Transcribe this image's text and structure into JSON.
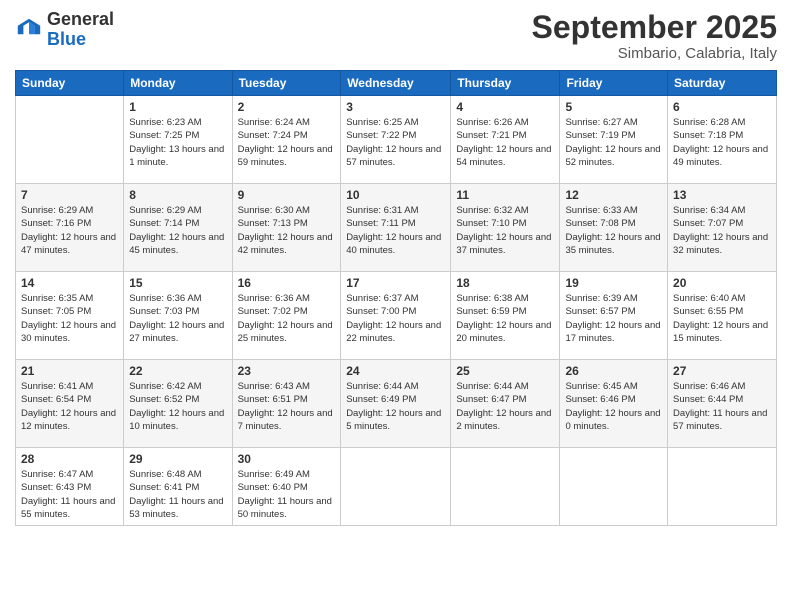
{
  "header": {
    "logo_general": "General",
    "logo_blue": "Blue",
    "month_title": "September 2025",
    "location": "Simbario, Calabria, Italy"
  },
  "weekdays": [
    "Sunday",
    "Monday",
    "Tuesday",
    "Wednesday",
    "Thursday",
    "Friday",
    "Saturday"
  ],
  "weeks": [
    [
      {
        "day": "",
        "info": ""
      },
      {
        "day": "1",
        "info": "Sunrise: 6:23 AM\nSunset: 7:25 PM\nDaylight: 13 hours\nand 1 minute."
      },
      {
        "day": "2",
        "info": "Sunrise: 6:24 AM\nSunset: 7:24 PM\nDaylight: 12 hours\nand 59 minutes."
      },
      {
        "day": "3",
        "info": "Sunrise: 6:25 AM\nSunset: 7:22 PM\nDaylight: 12 hours\nand 57 minutes."
      },
      {
        "day": "4",
        "info": "Sunrise: 6:26 AM\nSunset: 7:21 PM\nDaylight: 12 hours\nand 54 minutes."
      },
      {
        "day": "5",
        "info": "Sunrise: 6:27 AM\nSunset: 7:19 PM\nDaylight: 12 hours\nand 52 minutes."
      },
      {
        "day": "6",
        "info": "Sunrise: 6:28 AM\nSunset: 7:18 PM\nDaylight: 12 hours\nand 49 minutes."
      }
    ],
    [
      {
        "day": "7",
        "info": "Sunrise: 6:29 AM\nSunset: 7:16 PM\nDaylight: 12 hours\nand 47 minutes."
      },
      {
        "day": "8",
        "info": "Sunrise: 6:29 AM\nSunset: 7:14 PM\nDaylight: 12 hours\nand 45 minutes."
      },
      {
        "day": "9",
        "info": "Sunrise: 6:30 AM\nSunset: 7:13 PM\nDaylight: 12 hours\nand 42 minutes."
      },
      {
        "day": "10",
        "info": "Sunrise: 6:31 AM\nSunset: 7:11 PM\nDaylight: 12 hours\nand 40 minutes."
      },
      {
        "day": "11",
        "info": "Sunrise: 6:32 AM\nSunset: 7:10 PM\nDaylight: 12 hours\nand 37 minutes."
      },
      {
        "day": "12",
        "info": "Sunrise: 6:33 AM\nSunset: 7:08 PM\nDaylight: 12 hours\nand 35 minutes."
      },
      {
        "day": "13",
        "info": "Sunrise: 6:34 AM\nSunset: 7:07 PM\nDaylight: 12 hours\nand 32 minutes."
      }
    ],
    [
      {
        "day": "14",
        "info": "Sunrise: 6:35 AM\nSunset: 7:05 PM\nDaylight: 12 hours\nand 30 minutes."
      },
      {
        "day": "15",
        "info": "Sunrise: 6:36 AM\nSunset: 7:03 PM\nDaylight: 12 hours\nand 27 minutes."
      },
      {
        "day": "16",
        "info": "Sunrise: 6:36 AM\nSunset: 7:02 PM\nDaylight: 12 hours\nand 25 minutes."
      },
      {
        "day": "17",
        "info": "Sunrise: 6:37 AM\nSunset: 7:00 PM\nDaylight: 12 hours\nand 22 minutes."
      },
      {
        "day": "18",
        "info": "Sunrise: 6:38 AM\nSunset: 6:59 PM\nDaylight: 12 hours\nand 20 minutes."
      },
      {
        "day": "19",
        "info": "Sunrise: 6:39 AM\nSunset: 6:57 PM\nDaylight: 12 hours\nand 17 minutes."
      },
      {
        "day": "20",
        "info": "Sunrise: 6:40 AM\nSunset: 6:55 PM\nDaylight: 12 hours\nand 15 minutes."
      }
    ],
    [
      {
        "day": "21",
        "info": "Sunrise: 6:41 AM\nSunset: 6:54 PM\nDaylight: 12 hours\nand 12 minutes."
      },
      {
        "day": "22",
        "info": "Sunrise: 6:42 AM\nSunset: 6:52 PM\nDaylight: 12 hours\nand 10 minutes."
      },
      {
        "day": "23",
        "info": "Sunrise: 6:43 AM\nSunset: 6:51 PM\nDaylight: 12 hours\nand 7 minutes."
      },
      {
        "day": "24",
        "info": "Sunrise: 6:44 AM\nSunset: 6:49 PM\nDaylight: 12 hours\nand 5 minutes."
      },
      {
        "day": "25",
        "info": "Sunrise: 6:44 AM\nSunset: 6:47 PM\nDaylight: 12 hours\nand 2 minutes."
      },
      {
        "day": "26",
        "info": "Sunrise: 6:45 AM\nSunset: 6:46 PM\nDaylight: 12 hours\nand 0 minutes."
      },
      {
        "day": "27",
        "info": "Sunrise: 6:46 AM\nSunset: 6:44 PM\nDaylight: 11 hours\nand 57 minutes."
      }
    ],
    [
      {
        "day": "28",
        "info": "Sunrise: 6:47 AM\nSunset: 6:43 PM\nDaylight: 11 hours\nand 55 minutes."
      },
      {
        "day": "29",
        "info": "Sunrise: 6:48 AM\nSunset: 6:41 PM\nDaylight: 11 hours\nand 53 minutes."
      },
      {
        "day": "30",
        "info": "Sunrise: 6:49 AM\nSunset: 6:40 PM\nDaylight: 11 hours\nand 50 minutes."
      },
      {
        "day": "",
        "info": ""
      },
      {
        "day": "",
        "info": ""
      },
      {
        "day": "",
        "info": ""
      },
      {
        "day": "",
        "info": ""
      }
    ]
  ]
}
